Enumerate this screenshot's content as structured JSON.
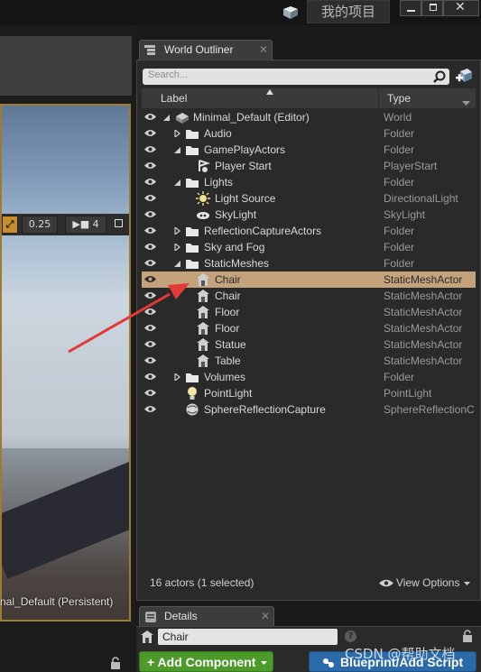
{
  "titlebar": {
    "project_name": "我的项目"
  },
  "viewport": {
    "scale_value": "0.25",
    "camera_speed": "4",
    "level_label": "nal_Default (Persistent)"
  },
  "world_outliner": {
    "tab_label": "World Outliner",
    "search_placeholder": "Search...",
    "columns": {
      "label": "Label",
      "type": "Type"
    },
    "rows": [
      {
        "label": "Minimal_Default (Editor)",
        "type": "World",
        "icon": "world-icon",
        "arrow": "down"
      },
      {
        "label": "Audio",
        "type": "Folder",
        "icon": "folder-icon",
        "arrow": "right"
      },
      {
        "label": "GamePlayActors",
        "type": "Folder",
        "icon": "folder-icon",
        "arrow": "down"
      },
      {
        "label": "Player Start",
        "type": "PlayerStart",
        "icon": "player-start-icon",
        "arrow": ""
      },
      {
        "label": "Lights",
        "type": "Folder",
        "icon": "folder-icon",
        "arrow": "down"
      },
      {
        "label": "Light Source",
        "type": "DirectionalLight",
        "icon": "directional-light-icon",
        "arrow": ""
      },
      {
        "label": "SkyLight",
        "type": "SkyLight",
        "icon": "skylight-icon",
        "arrow": ""
      },
      {
        "label": "ReflectionCaptureActors",
        "type": "Folder",
        "icon": "folder-icon",
        "arrow": "right"
      },
      {
        "label": "Sky and Fog",
        "type": "Folder",
        "icon": "folder-icon",
        "arrow": "right"
      },
      {
        "label": "StaticMeshes",
        "type": "Folder",
        "icon": "folder-icon",
        "arrow": "down"
      },
      {
        "label": "Chair",
        "type": "StaticMeshActor",
        "icon": "static-mesh-icon",
        "arrow": "",
        "selected": true
      },
      {
        "label": "Chair",
        "type": "StaticMeshActor",
        "icon": "static-mesh-icon",
        "arrow": ""
      },
      {
        "label": "Floor",
        "type": "StaticMeshActor",
        "icon": "static-mesh-icon",
        "arrow": ""
      },
      {
        "label": "Floor",
        "type": "StaticMeshActor",
        "icon": "static-mesh-icon",
        "arrow": ""
      },
      {
        "label": "Statue",
        "type": "StaticMeshActor",
        "icon": "static-mesh-icon",
        "arrow": ""
      },
      {
        "label": "Table",
        "type": "StaticMeshActor",
        "icon": "static-mesh-icon",
        "arrow": ""
      },
      {
        "label": "Volumes",
        "type": "Folder",
        "icon": "folder-icon",
        "arrow": "right"
      },
      {
        "label": "PointLight",
        "type": "PointLight",
        "icon": "point-light-icon",
        "arrow": ""
      },
      {
        "label": "SphereReflectionCapture",
        "type": "SphereReflectionC",
        "icon": "sphere-reflection-icon",
        "arrow": ""
      }
    ],
    "status": "16 actors (1 selected)",
    "view_options_label": "View Options"
  },
  "details": {
    "tab_label": "Details",
    "actor_name": "Chair",
    "add_component_label": "+ Add Component",
    "blueprint_label": "Blueprint/Add Script"
  },
  "watermark": "CSDN @帮助文档",
  "colors": {
    "selection": "#c4a27c",
    "add_component": "#4c9a2a",
    "blueprint": "#2a6aa8",
    "annotation_arrow": "#e53935"
  }
}
